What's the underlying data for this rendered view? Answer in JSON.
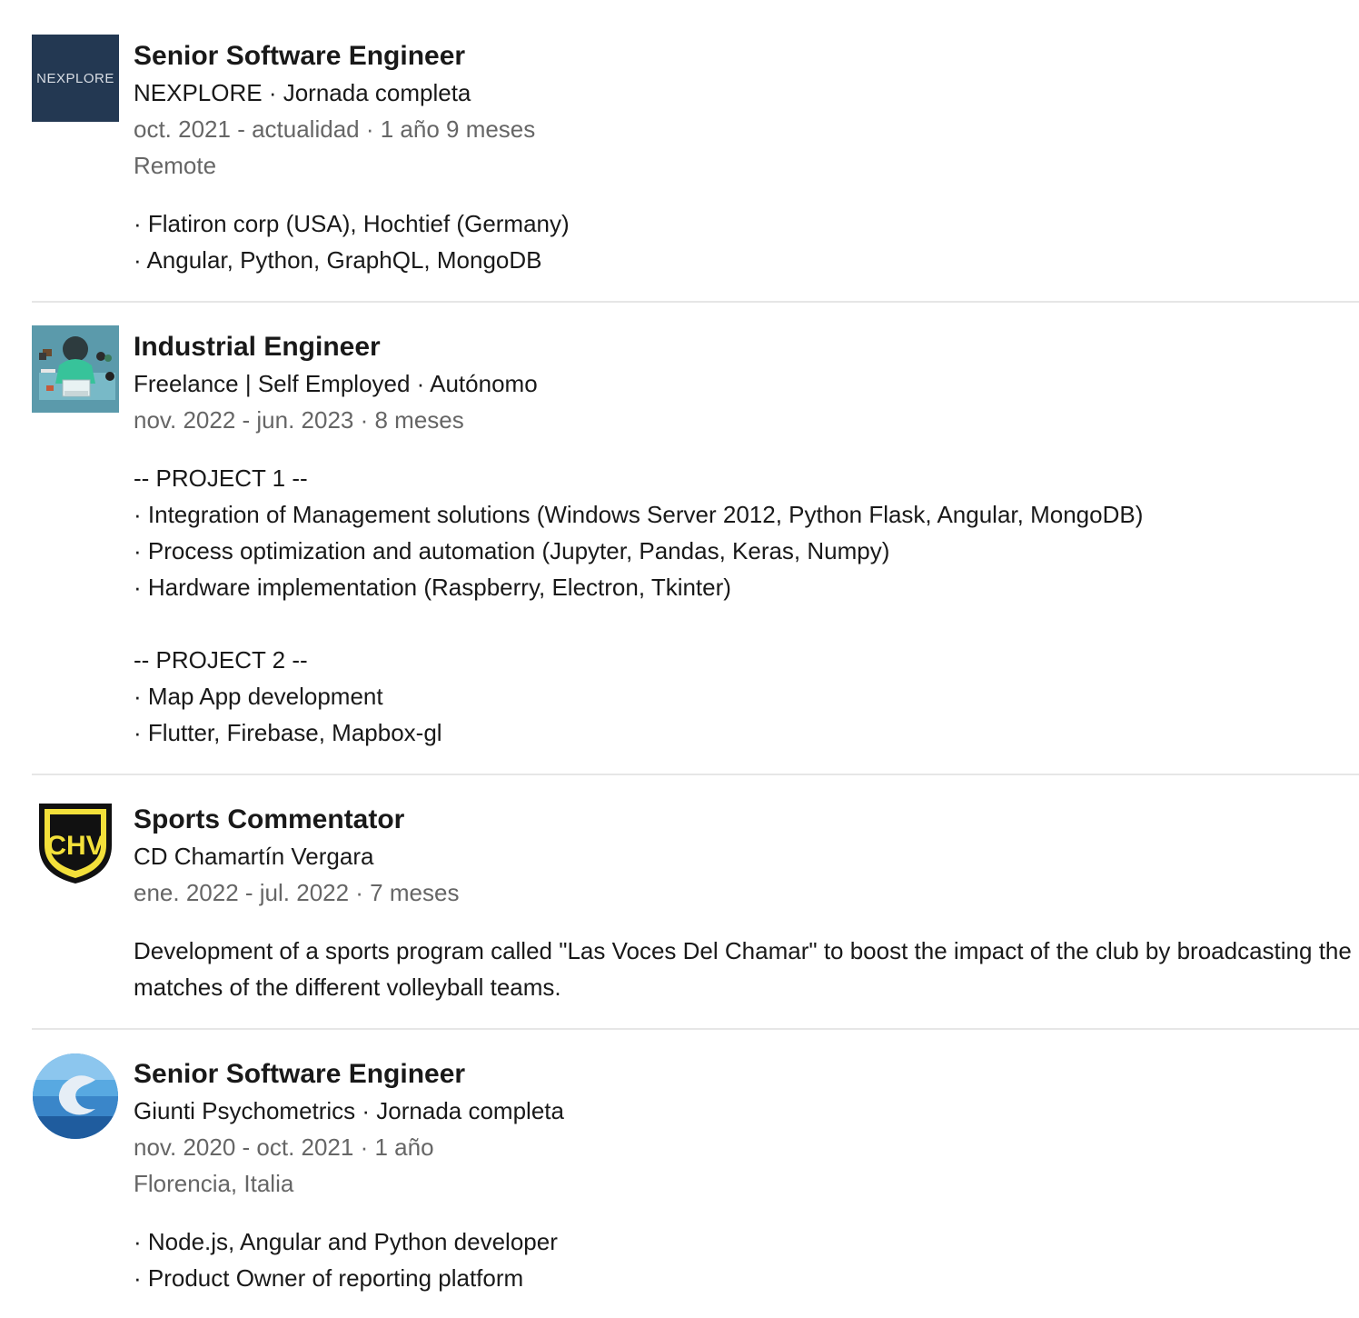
{
  "experiences": [
    {
      "logo_text": "NEXPLORE",
      "title": "Senior Software Engineer",
      "company": "NEXPLORE · Jornada completa",
      "dates": "oct. 2021 - actualidad · 1 año 9 meses",
      "location": "Remote",
      "lines": [
        "· Flatiron corp (USA), Hochtief (Germany)",
        "· Angular, Python, GraphQL, MongoDB"
      ]
    },
    {
      "title": "Industrial Engineer",
      "company": "Freelance | Self Employed · Autónomo",
      "dates": "nov. 2022 - jun. 2023 · 8 meses",
      "lines": [
        "-- PROJECT 1 --",
        "· Integration of Management solutions (Windows Server 2012, Python Flask, Angular, MongoDB)",
        "· Process optimization and automation (Jupyter, Pandas, Keras, Numpy)",
        "· Hardware implementation (Raspberry, Electron, Tkinter)",
        "",
        "-- PROJECT 2 --",
        "· Map App development",
        "· Flutter, Firebase, Mapbox-gl"
      ]
    },
    {
      "logo_text": "CHV",
      "title": "Sports Commentator",
      "company": "CD Chamartín Vergara",
      "dates": "ene. 2022 - jul. 2022 · 7 meses",
      "lines": [
        "Development of a sports program called \"Las Voces Del Chamar\" to boost the impact of the club by broadcasting the matches of the different volleyball teams."
      ]
    },
    {
      "title": "Senior Software Engineer",
      "company": "Giunti Psychometrics · Jornada completa",
      "dates": "nov. 2020 - oct. 2021 · 1 año",
      "location": "Florencia, Italia",
      "lines": [
        "· Node.js, Angular and Python developer",
        "· Product Owner of reporting platform"
      ]
    }
  ]
}
